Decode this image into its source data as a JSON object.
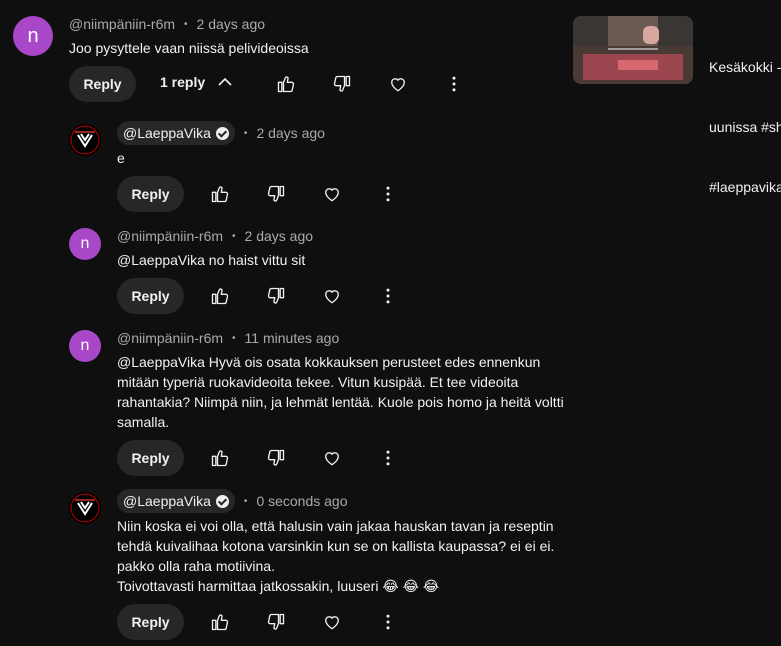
{
  "comments": [
    {
      "avatar_letter": "n",
      "avatar_color": "#a848c8",
      "author": "@niimpäniin-r6m",
      "time": "2 days ago",
      "text": "Joo pysyttele vaan niissä pelivideoissa",
      "reply_label": "Reply",
      "replies_toggle": "1 reply"
    },
    {
      "avatar": "LaeppaVika-logo",
      "author": "@LaeppaVika",
      "verified": true,
      "time": "2 days ago",
      "text": "e",
      "reply_label": "Reply"
    },
    {
      "avatar_letter": "n",
      "avatar_color": "#a848c8",
      "author": "@niimpäniin-r6m",
      "time": "2 days ago",
      "text": "@LaeppaVika no haist vittu sit",
      "reply_label": "Reply"
    },
    {
      "avatar_letter": "n",
      "avatar_color": "#a848c8",
      "author": "@niimpäniin-r6m",
      "time": "11 minutes ago",
      "text_lines": [
        "@LaeppaVika Hyvä ois osata kokkauksen perusteet edes ennenkun",
        "mitään typeriä ruokavideoita tekee. Vitun kusipää. Et tee videoita",
        "rahantakia? Niimpä niin, ja lehmät lentää. Kuole pois homo ja heitä voltti",
        "samalla."
      ],
      "reply_label": "Reply"
    },
    {
      "avatar": "LaeppaVika-logo",
      "author": "@LaeppaVika",
      "verified": true,
      "time": "0 seconds ago",
      "text_lines": [
        "Niin koska ei voi olla, että halusin vain jakaa hauskan tavan ja reseptin",
        "tehdä kuivalihaa kotona varsinkin kun se on kallista kaupassa? ei ei ei.",
        "pakko olla raha motiivina.",
        "Toivottavasti harmittaa jatkossakin, luuseri 😂 😂 😂"
      ],
      "reply_label": "Reply"
    }
  ],
  "side_video": {
    "title_lines": [
      "Kesäkokki - ",
      "uunissa #sh",
      "#laeppavika"
    ]
  },
  "icons": [
    "thumb-up-icon",
    "thumb-down-icon",
    "heart-icon",
    "more-vert-icon",
    "chevron-up-icon"
  ]
}
